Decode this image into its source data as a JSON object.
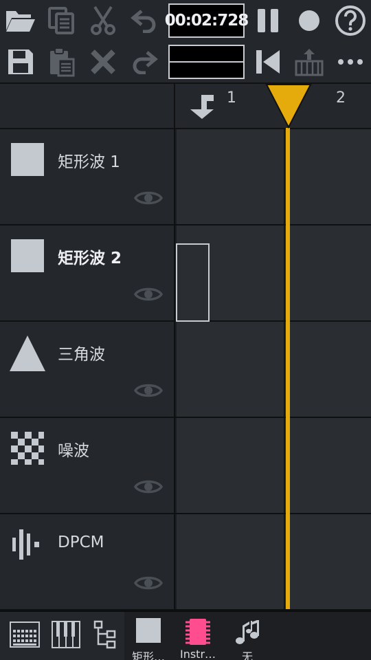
{
  "toolbar": {
    "timecode": "00:02:728",
    "row1": [
      "open-folder-icon",
      "copy-icon",
      "cut-icon",
      "undo-icon",
      "pause-icon",
      "record-icon",
      "help-icon"
    ],
    "row2": [
      "save-icon",
      "paste-icon",
      "delete-icon",
      "redo-icon",
      "rewind-to-start-icon",
      "piano-export-icon",
      "more-icon"
    ]
  },
  "header": {
    "bar_numbers": [
      "1",
      "2"
    ],
    "insert_icon": "insert-arrow-icon"
  },
  "channels": [
    {
      "name": "矩形波 1",
      "icon": "square-wave-icon",
      "active": false
    },
    {
      "name": "矩形波 2",
      "icon": "square-wave-icon",
      "active": true
    },
    {
      "name": "三角波",
      "icon": "triangle-wave-icon",
      "active": false
    },
    {
      "name": "噪波",
      "icon": "noise-icon",
      "active": false
    },
    {
      "name": "DPCM",
      "icon": "dpcm-icon",
      "active": false
    }
  ],
  "bottombar": {
    "items": [
      {
        "label": "矩形…",
        "icon": "square-wave-icon"
      },
      {
        "label": "Instr…",
        "icon": "instrument-chip-icon"
      },
      {
        "label": "无",
        "icon": "music-notes-icon"
      }
    ]
  },
  "colors": {
    "playhead": "#e5aa0c",
    "instrument_accent": "#ff4d8f",
    "icon_light": "#c4c8cf",
    "icon_dim": "#5b5f66"
  }
}
